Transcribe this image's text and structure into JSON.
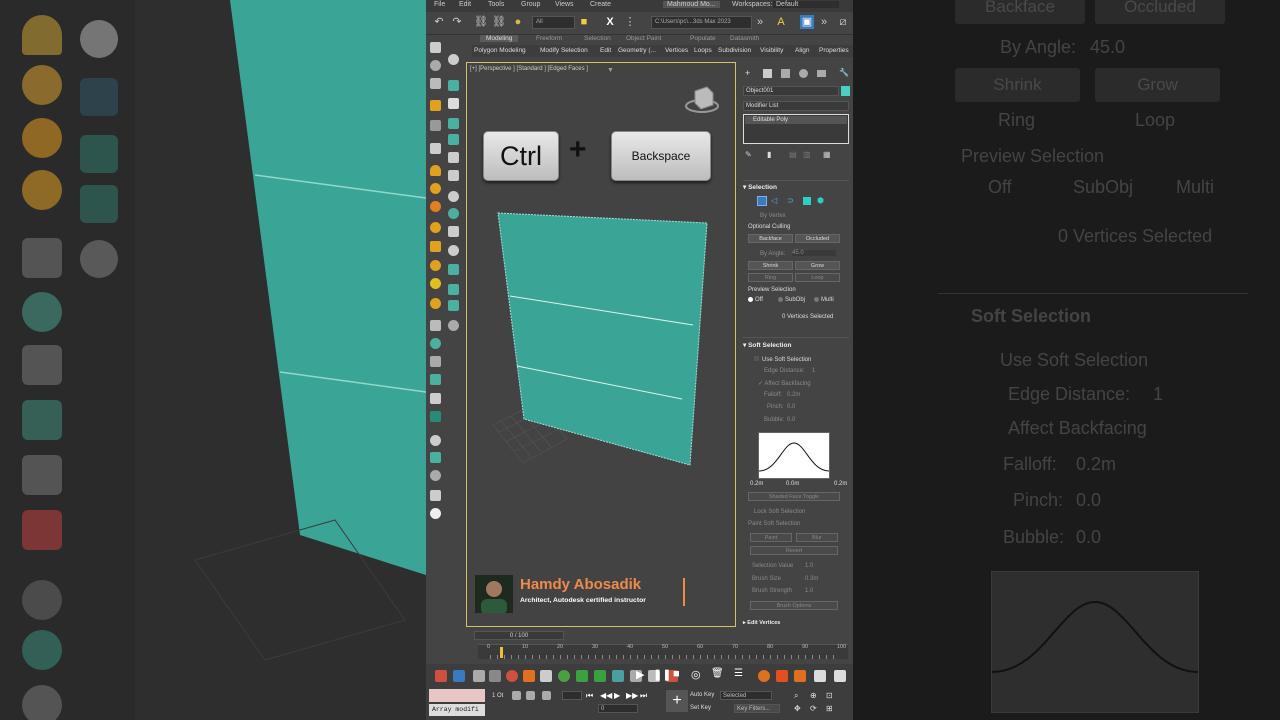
{
  "menu": {
    "items": [
      "File",
      "Edit",
      "Tools",
      "Group",
      "Views",
      "Create"
    ],
    "user": "Mahmoud Mo...",
    "workspaces_label": "Workspaces:",
    "workspace_value": "Default"
  },
  "toolbar": {
    "selection_filter": "All",
    "path": "C:\\Users\\pc\\...3ds Max 2023"
  },
  "ribbon": {
    "tabs": [
      "Modeling",
      "Freeform",
      "Selection",
      "Object Paint",
      "Populate",
      "Datasmith"
    ],
    "active_tab": "Modeling",
    "items": [
      "Polygon Modeling",
      "Modify Selection",
      "Edit",
      "Geometry (...",
      "Vertices",
      "Loops",
      "Subdivision",
      "Visibility",
      "Align",
      "Properties"
    ]
  },
  "viewport": {
    "label": "[+] [Perspective ] [Standard ] [Edged Faces ]",
    "keys": {
      "key1": "Ctrl",
      "plus": "+",
      "key2": "Backspace"
    },
    "mesh_color": "#3aa596",
    "watermark": {
      "name": "Hamdy Abosadik",
      "subtitle": "Architect, Autodesk certified instructor"
    }
  },
  "command_panel": {
    "object_name": "Object001",
    "object_color": "#4ad0c0",
    "modifier_list": "Modifier List",
    "stack_item": "Editable Poly",
    "selection": {
      "header": "Selection",
      "by_vertex": "By Vertex",
      "optional_culling": "Optional Culling",
      "backface": "Backface",
      "occluded": "Occluded",
      "by_angle_label": "By Angle:",
      "by_angle_value": "45.0",
      "shrink": "Shrink",
      "grow": "Grow",
      "ring": "Ring",
      "loop": "Loop",
      "preview_selection": "Preview Selection",
      "preview_off": "Off",
      "preview_subobj": "SubObj",
      "preview_multi": "Multi",
      "status": "0 Vertices Selected"
    },
    "soft_selection": {
      "header": "Soft Selection",
      "use_soft": "Use Soft Selection",
      "edge_distance_label": "Edge Distance:",
      "edge_distance_value": "1",
      "affect_backfacing": "Affect Backfacing",
      "falloff_label": "Falloff:",
      "falloff_value": "0.2m",
      "pinch_label": "Pinch:",
      "pinch_value": "0.0",
      "bubble_label": "Bubble:",
      "bubble_value": "0.0",
      "curve_left": "0.2m",
      "curve_mid": "0.0m",
      "curve_right": "0.2m",
      "shaded_face_toggle": "Shaded Face Toggle",
      "lock_soft": "Lock Soft Selection",
      "paint_soft": "Paint Soft Selection",
      "paint": "Paint",
      "blur": "Blur",
      "revert": "Revert",
      "selection_value_label": "Selection Value",
      "selection_value": "1.0",
      "brush_size_label": "Brush Size",
      "brush_size": "0.3m",
      "brush_strength_label": "Brush Strength",
      "brush_strength": "1.0",
      "brush_options": "Brush Options",
      "edit_vertices": "Edit Vertices"
    }
  },
  "timeline": {
    "frame": "0 / 100",
    "ticks": [
      "0",
      "10",
      "20",
      "30",
      "40",
      "50",
      "60",
      "70",
      "80",
      "90",
      "100"
    ]
  },
  "statusbar": {
    "maxscript": "Array modifi",
    "object_count": "1 Ot",
    "auto_key": "Auto Key",
    "selected": "Selected",
    "set_key": "Set Key",
    "key_filters": "Key Filters...",
    "frame_value": "0"
  },
  "background_right": {
    "backface": "Backface",
    "occluded": "Occluded",
    "by_angle": "By Angle:",
    "by_angle_value": "45.0",
    "shrink": "Shrink",
    "grow": "Grow",
    "ring": "Ring",
    "loop": "Loop",
    "preview_selection": "Preview Selection",
    "off": "Off",
    "subobj": "SubObj",
    "multi": "Multi",
    "status": "0 Vertices Selected",
    "soft_selection": "Soft Selection",
    "use_soft": "Use Soft Selection",
    "edge_distance": "Edge Distance:",
    "edge_distance_value": "1",
    "affect_backfacing": "Affect Backfacing",
    "falloff": "Falloff:",
    "falloff_value": "0.2m",
    "pinch": "Pinch:",
    "pinch_value": "0.0",
    "bubble": "Bubble:",
    "bubble_value": "0.0"
  }
}
